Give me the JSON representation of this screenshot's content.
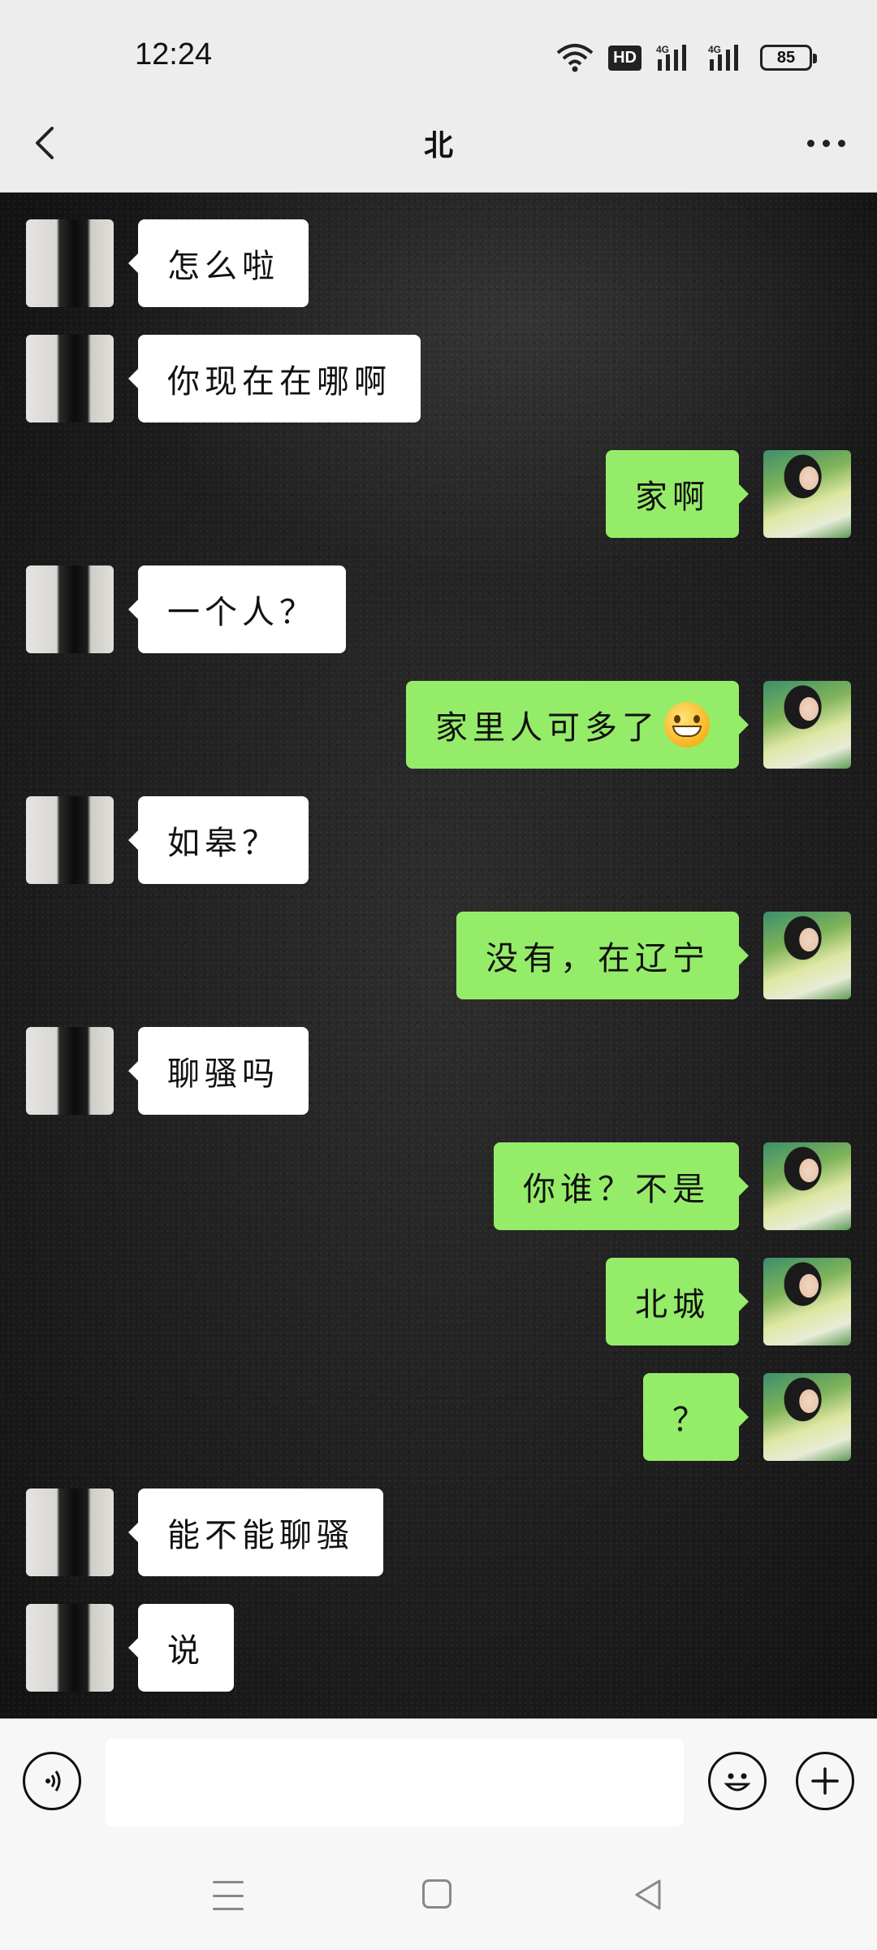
{
  "status_bar": {
    "time": "12:24",
    "hd_label": "HD",
    "battery": "85"
  },
  "header": {
    "title": "北",
    "back_icon": "chevron-left-icon",
    "more_icon": "more-dots-icon"
  },
  "messages": [
    {
      "side": "left",
      "text": "怎么啦"
    },
    {
      "side": "left",
      "text": "你现在在哪啊"
    },
    {
      "side": "right",
      "text": "家啊"
    },
    {
      "side": "left",
      "text": "一个人？"
    },
    {
      "side": "right",
      "text": "家里人可多了",
      "emoji": "grinning-face"
    },
    {
      "side": "left",
      "text": "如皋？"
    },
    {
      "side": "right",
      "text": "没有，在辽宁"
    },
    {
      "side": "left",
      "text": "聊骚吗"
    },
    {
      "side": "right",
      "text": "你谁？不是"
    },
    {
      "side": "right",
      "text": "北城"
    },
    {
      "side": "right",
      "text": "？"
    },
    {
      "side": "left",
      "text": "能不能聊骚"
    },
    {
      "side": "left",
      "text": "说"
    }
  ],
  "input_bar": {
    "placeholder": "",
    "voice_icon": "voice-icon",
    "emoji_icon": "smile-icon",
    "plus_icon": "plus-icon"
  },
  "colors": {
    "self_bubble": "#95ec69",
    "other_bubble": "#ffffff",
    "header_bg": "#ededed"
  }
}
